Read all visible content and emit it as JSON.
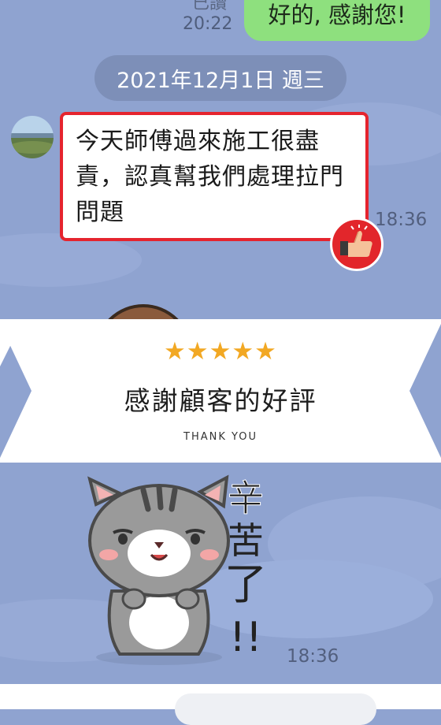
{
  "chat": {
    "read_label": "已讀",
    "time_top": "20:22",
    "sent_message": "好的, 感謝您!",
    "date_pill": "2021年12月1日 週三",
    "received_message": "今天師傅過來施工很盡責，認真幫我們處理拉門問題",
    "received_time": "18:36",
    "sticker_time": "18:36"
  },
  "sticker": {
    "caption": "辛苦了!!"
  },
  "review_card": {
    "stars": "★★★★★",
    "rating": 5,
    "title": "感謝顧客的好評",
    "subtitle": "THANK YOU"
  },
  "colors": {
    "chat_background": "#8fa3d0",
    "sent_bubble": "#8ee07e",
    "highlight_border": "#e5242e",
    "star": "#f2a823",
    "badge": "#e2262b"
  },
  "icons": {
    "thumbs_up_badge": "thumbs-up-icon",
    "avatar": "avatar-landscape"
  }
}
